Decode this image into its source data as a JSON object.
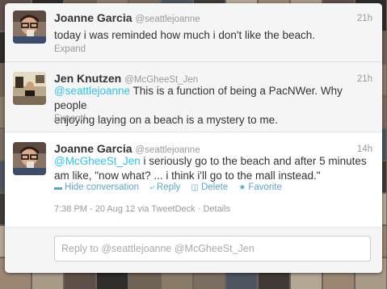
{
  "tweets": [
    {
      "name": "Joanne Garcia",
      "handle": "@seattlejoanne",
      "time": "21h",
      "text": "today i was reminded how much i don't like the beach.",
      "expand": "Expand"
    },
    {
      "name": "Jen Knutzen",
      "handle": "@McGheeSt_Jen",
      "time": "21h",
      "mention": "@seattlejoanne",
      "text_line1": " This is a function of being a PacNWer. Why people",
      "text_line2": "enjoying laying on a beach is a mystery to me.",
      "expand": "Expand"
    },
    {
      "name": "Joanne Garcia",
      "handle": "@seattlejoanne",
      "time": "14h",
      "mention": "@McGheeSt_Jen",
      "text_line1": " i seriously go to the beach and after 5 minutes",
      "text_line2": "am like, \"now what? ... i think i'll go to the mall instead.\"",
      "actions": {
        "hide": "Hide conversation",
        "reply": "Reply",
        "delete": "Delete",
        "favorite": "Favorite"
      },
      "meta": "7:38 PM - 20 Aug 12 via TweetDeck · Details"
    }
  ],
  "reply_box": {
    "placeholder": "Reply to @seattlejoanne @McGheeSt_Jen"
  },
  "colors": {
    "mention": "#2fc2ef",
    "action": "#5aa7c8"
  }
}
